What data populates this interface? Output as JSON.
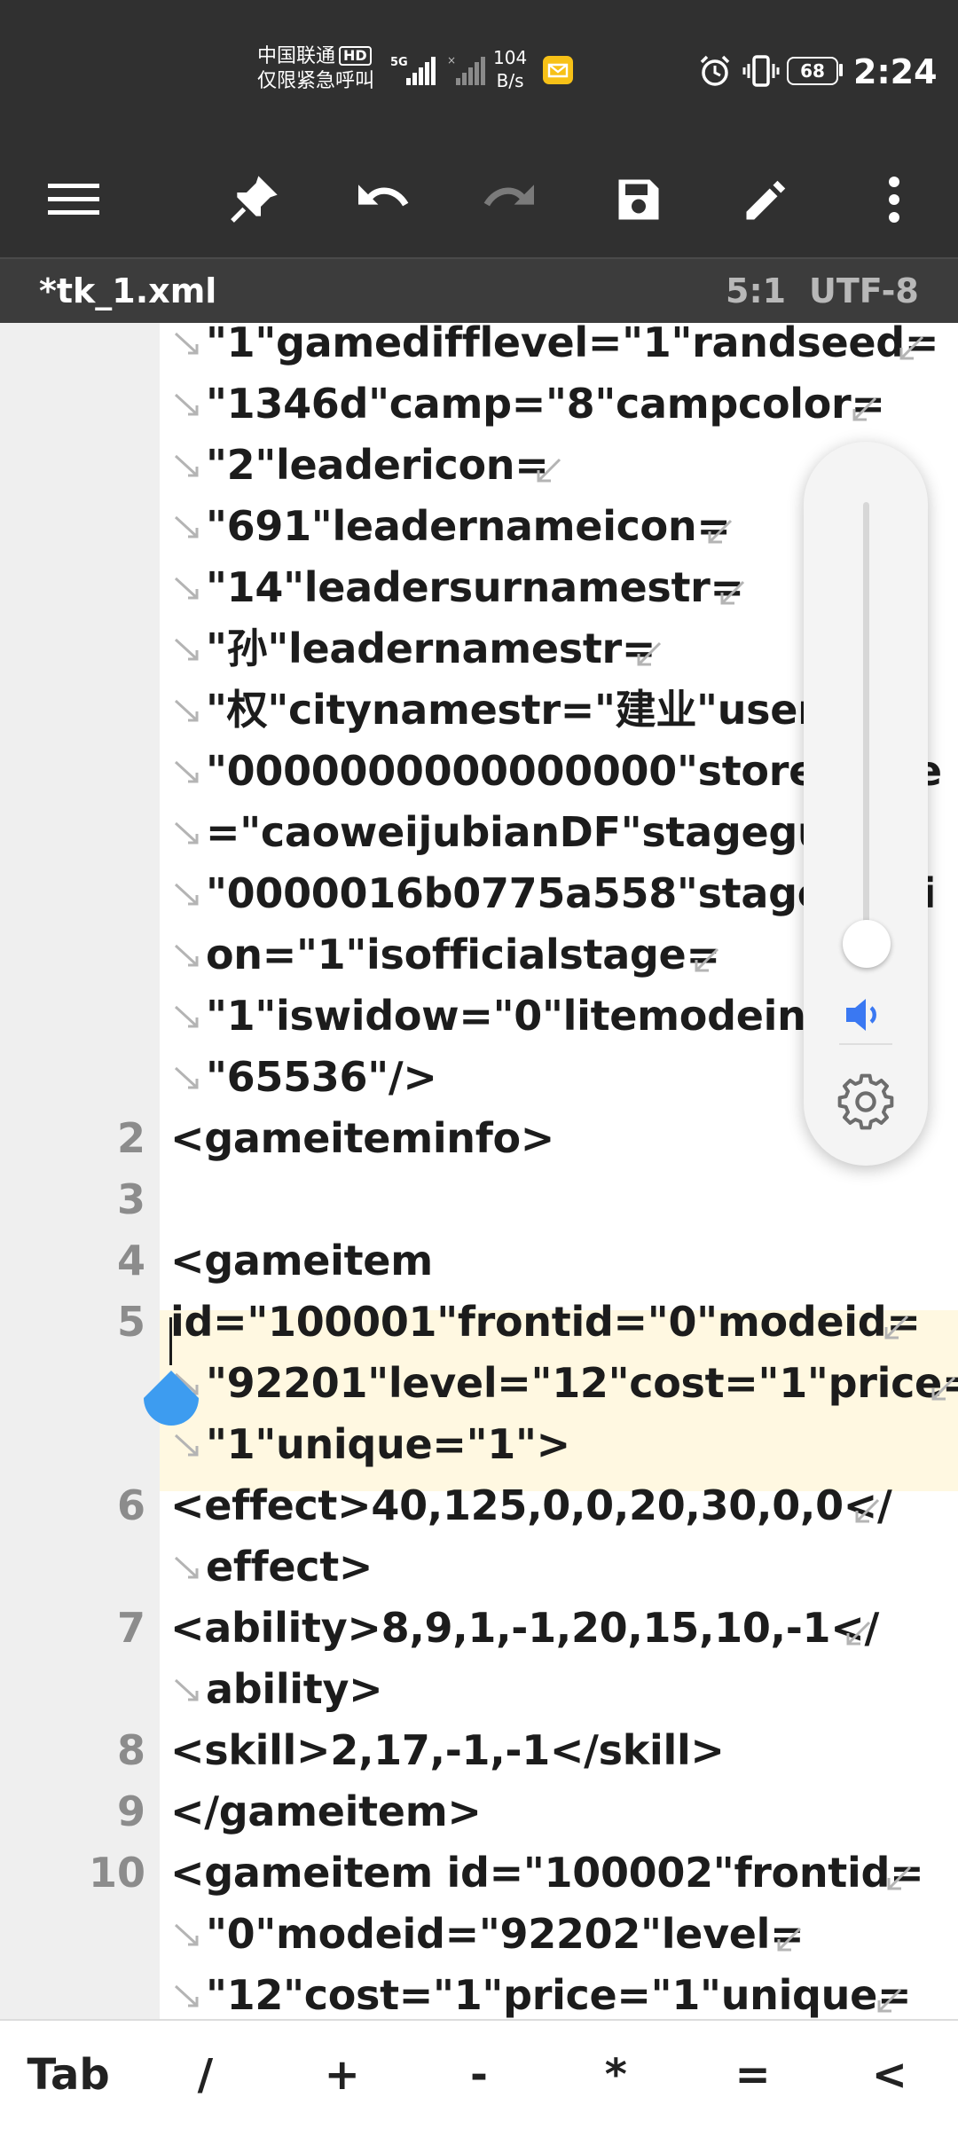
{
  "status_bar": {
    "carrier_line1": "中国联通",
    "carrier_badge": "HD",
    "carrier_line2": "仅限紧急呼叫",
    "network": "5G",
    "speed_value": "104",
    "speed_unit": "B/s",
    "battery": "68",
    "time": "2:24"
  },
  "toolbar": {
    "items": [
      "menu-icon",
      "pin-icon",
      "undo-icon",
      "redo-icon",
      "save-icon",
      "edit-icon",
      "more-icon"
    ]
  },
  "file_bar": {
    "file_name": "*tk_1.xml",
    "cursor_position": "5:1",
    "encoding": "UTF-8"
  },
  "editor": {
    "rows": [
      {
        "num": "",
        "text": "\"1\"gamedifflevel=\"1\"randseed=",
        "wrap_in": true,
        "wrap_out": true
      },
      {
        "num": "",
        "text": "\"1346d\"camp=\"8\"campcolor=",
        "wrap_in": true,
        "wrap_out": true
      },
      {
        "num": "",
        "text": "\"2\"leadericon=",
        "wrap_in": true,
        "wrap_out": true
      },
      {
        "num": "",
        "text": "\"691\"leadernameicon=",
        "wrap_in": true,
        "wrap_out": true
      },
      {
        "num": "",
        "text": "\"14\"leadersurnamestr=",
        "wrap_in": true,
        "wrap_out": true
      },
      {
        "num": "",
        "text": "\"孙\"leadernamestr=",
        "wrap_in": true,
        "wrap_out": true
      },
      {
        "num": "",
        "text": "\"权\"citynamestr=\"建业\"userid=",
        "wrap_in": true,
        "wrap_out": false
      },
      {
        "num": "",
        "text": "\"0000000000000000\"storename",
        "wrap_in": true,
        "wrap_out": false
      },
      {
        "num": "",
        "text": "=\"caoweijubianDF\"stageguid=",
        "wrap_in": true,
        "wrap_out": false
      },
      {
        "num": "",
        "text": "\"0000016b0775a558\"stageversi",
        "wrap_in": true,
        "wrap_out": false
      },
      {
        "num": "",
        "text": "on=\"1\"isofficialstage=",
        "wrap_in": true,
        "wrap_out": true
      },
      {
        "num": "",
        "text": "\"1\"iswidow=\"0\"litemodeindex=",
        "wrap_in": true,
        "wrap_out": false
      },
      {
        "num": "",
        "text": "\"65536\"/>",
        "wrap_in": true,
        "wrap_out": false
      },
      {
        "num": "2",
        "text": "<gameiteminfo>",
        "wrap_in": false,
        "wrap_out": false
      },
      {
        "num": "3",
        "text": "",
        "wrap_in": false,
        "wrap_out": false
      },
      {
        "num": "4",
        "text": "<gameitem",
        "wrap_in": false,
        "wrap_out": false
      },
      {
        "num": "5",
        "text": "id=\"100001\"frontid=\"0\"modeid=",
        "wrap_in": false,
        "wrap_out": true
      },
      {
        "num": "",
        "text": "\"92201\"level=\"12\"cost=\"1\"price=",
        "wrap_in": true,
        "wrap_out": true
      },
      {
        "num": "",
        "text": "\"1\"unique=\"1\">",
        "wrap_in": true,
        "wrap_out": false
      },
      {
        "num": "6",
        "text": "<effect>40,125,0,0,20,30,0,0</",
        "wrap_in": false,
        "wrap_out": true
      },
      {
        "num": "",
        "text": "effect>",
        "wrap_in": true,
        "wrap_out": false
      },
      {
        "num": "7",
        "text": "<ability>8,9,1,-1,20,15,10,-1</",
        "wrap_in": false,
        "wrap_out": true
      },
      {
        "num": "",
        "text": "ability>",
        "wrap_in": true,
        "wrap_out": false
      },
      {
        "num": "8",
        "text": "<skill>2,17,-1,-1</skill>",
        "wrap_in": false,
        "wrap_out": false
      },
      {
        "num": "9",
        "text": "</gameitem>",
        "wrap_in": false,
        "wrap_out": false
      },
      {
        "num": "10",
        "text": "<gameitem id=\"100002\"frontid=",
        "wrap_in": false,
        "wrap_out": true
      },
      {
        "num": "",
        "text": "\"0\"modeid=\"92202\"level=",
        "wrap_in": true,
        "wrap_out": true
      },
      {
        "num": "",
        "text": "\"12\"cost=\"1\"price=\"1\"unique=",
        "wrap_in": true,
        "wrap_out": true
      }
    ]
  },
  "volume_panel": {
    "level": 0.05,
    "accent": "#3a78f2",
    "icons": [
      "speaker-icon",
      "settings-gear-icon"
    ]
  },
  "key_bar": {
    "keys": [
      "Tab",
      "/",
      "+",
      "-",
      "*",
      "=",
      "<"
    ]
  }
}
